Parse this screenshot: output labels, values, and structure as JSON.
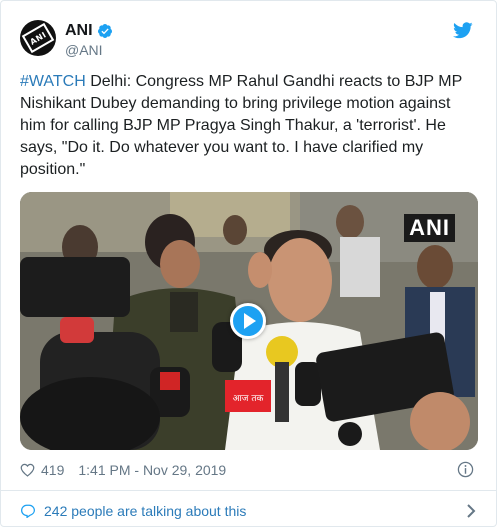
{
  "account": {
    "display_name": "ANI",
    "handle": "@ANI",
    "avatar_text": "ANI"
  },
  "tweet": {
    "hashtag": "#WATCH",
    "body": " Delhi: Congress MP Rahul Gandhi reacts to BJP MP Nishikant Dubey demanding to bring privilege motion against him for calling BJP MP Pragya Singh Thakur, a 'terrorist'. He says, \"Do it. Do whatever you want to. I have clarified my position.\""
  },
  "media": {
    "watermark": "ANI",
    "mic_label": "आज तक"
  },
  "meta": {
    "likes": "419",
    "timestamp": "1:41 PM - Nov 29, 2019"
  },
  "footer": {
    "talking": "242 people are talking about this"
  },
  "icons": {
    "verified": "verified-badge-icon",
    "logo": "twitter-bird-icon",
    "like": "heart-icon",
    "info": "info-icon",
    "talk": "comment-bubble-icon",
    "chevron": "chevron-right-icon",
    "play": "play-icon"
  },
  "colors": {
    "link": "#2b7bb9",
    "accent": "#1da1f2",
    "muted": "#657786",
    "text": "#1c2022"
  }
}
